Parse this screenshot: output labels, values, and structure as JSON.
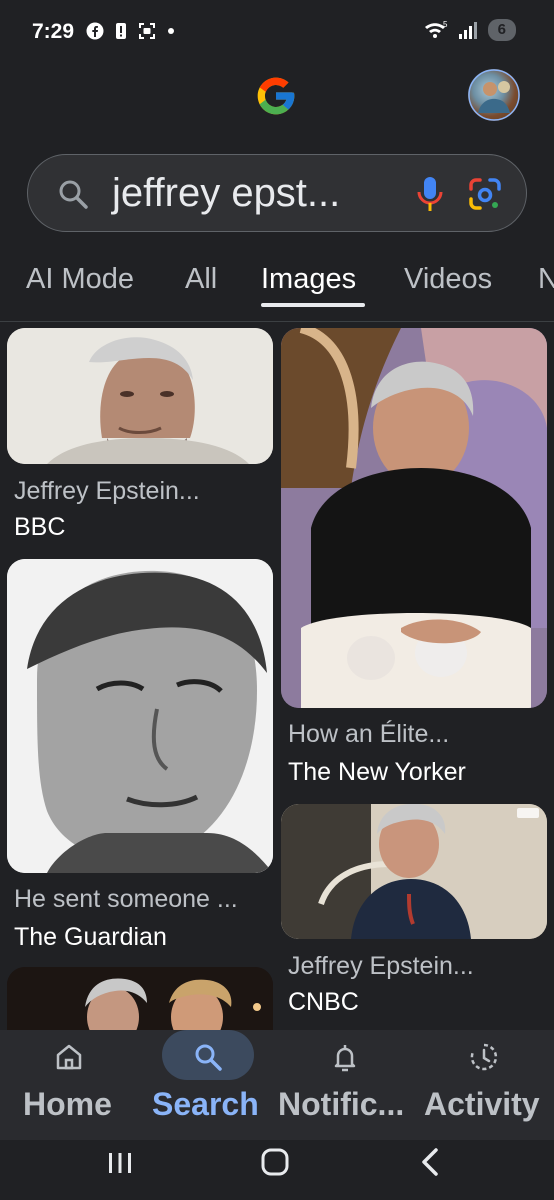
{
  "status": {
    "time": "7:29",
    "battery": "6",
    "signal_label": "5"
  },
  "header": {
    "logo_icon": "google-g-icon",
    "avatar_icon": "profile-avatar"
  },
  "search": {
    "query": "jeffrey epst..."
  },
  "tabs": [
    {
      "label": "AI Mode"
    },
    {
      "label": "All"
    },
    {
      "label": "Images"
    },
    {
      "label": "Videos"
    },
    {
      "label": "N"
    }
  ],
  "results": [
    {
      "title": "Jeffrey Epstein...",
      "source": "BBC"
    },
    {
      "title": "How an Élite...",
      "source": "The New Yorker"
    },
    {
      "title": "He sent someone ...",
      "source": "The Guardian"
    },
    {
      "title": "Jeffrey Epstein...",
      "source": "CNBC"
    }
  ],
  "bottom_nav": [
    {
      "label": "Home"
    },
    {
      "label": "Search"
    },
    {
      "label": "Notific..."
    },
    {
      "label": "Activity"
    }
  ],
  "colors": {
    "accent": "#8ab4f8",
    "bg": "#202124"
  }
}
